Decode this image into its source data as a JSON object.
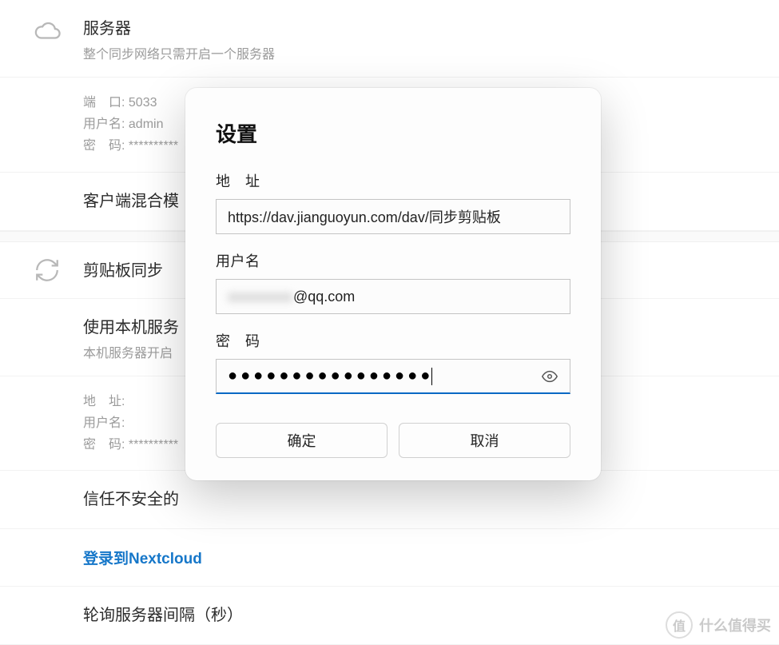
{
  "bg": {
    "server": {
      "title": "服务器",
      "sub": "整个同步网络只需开启一个服务器",
      "port_label": "端　口: 5033",
      "user_label": "用户名: admin",
      "pass_label": "密　码: **********"
    },
    "client_mode": "客户端混合模",
    "clipboard_sync": "剪贴板同步",
    "use_local": {
      "title": "使用本机服务",
      "sub": "本机服务器开启"
    },
    "details2": {
      "addr_label": "地　址:",
      "user_label": "用户名:",
      "pass_label": "密　码: **********"
    },
    "trust_insecure": "信任不安全的",
    "nextcloud_link": "登录到Nextcloud",
    "poll_label": "轮询服务器间隔（秒）"
  },
  "modal": {
    "title": "设置",
    "fields": {
      "address": {
        "label": "地　址",
        "value": "https://dav.jianguoyun.com/dav/同步剪贴板"
      },
      "username": {
        "label": "用户名",
        "value": "@qq.com"
      },
      "password": {
        "label": "密　码",
        "value": "●●●●●●●●●●●●●●●●"
      }
    },
    "buttons": {
      "ok": "确定",
      "cancel": "取消"
    }
  },
  "watermark": {
    "badge": "值",
    "text": "什么值得买"
  }
}
